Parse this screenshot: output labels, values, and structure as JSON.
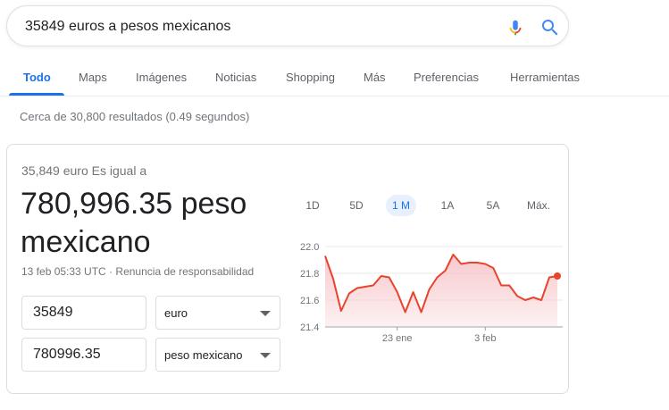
{
  "search": {
    "query": "35849 euros a pesos mexicanos"
  },
  "icons": {
    "mic": "microphone-icon",
    "search": "search-icon"
  },
  "colors": {
    "accent": "#1a73e8",
    "line": "#e8442d",
    "fill": "#f7c6ca"
  },
  "tabs": [
    {
      "label": "Todo",
      "active": true
    },
    {
      "label": "Maps"
    },
    {
      "label": "Imágenes"
    },
    {
      "label": "Noticias"
    },
    {
      "label": "Shopping"
    },
    {
      "label": "Más"
    },
    {
      "label": "Preferencias"
    },
    {
      "label": "Herramientas"
    }
  ],
  "stats": "Cerca de 30,800 resultados (0.49 segundos)",
  "converter": {
    "equal_label": "35,849 euro Es igual a",
    "result": "780,996.35 peso mexicano",
    "timestamp": "13 feb 05:33 UTC",
    "separator": "·",
    "disclaimer": "Renuncia de responsabilidad",
    "from_amount": "35849",
    "from_currency": "euro",
    "to_amount": "780996.35",
    "to_currency": "peso mexicano"
  },
  "ranges": [
    "1D",
    "5D",
    "1 M",
    "1A",
    "5A",
    "Máx."
  ],
  "active_range": "1 M",
  "chart_data": {
    "type": "area",
    "x_tick_labels": [
      "23 ene",
      "3 feb"
    ],
    "y_ticks": [
      21.4,
      21.6,
      21.8,
      22.0
    ],
    "ylim": [
      21.4,
      22.0
    ],
    "grid": true,
    "values": [
      21.93,
      21.76,
      21.52,
      21.65,
      21.69,
      21.7,
      21.71,
      21.78,
      21.77,
      21.66,
      21.51,
      21.66,
      21.51,
      21.68,
      21.77,
      21.82,
      21.94,
      21.87,
      21.88,
      21.88,
      21.87,
      21.84,
      21.71,
      21.71,
      21.63,
      21.6,
      21.62,
      21.6,
      21.77,
      21.78
    ],
    "x_tick_indices": [
      9,
      20
    ]
  }
}
